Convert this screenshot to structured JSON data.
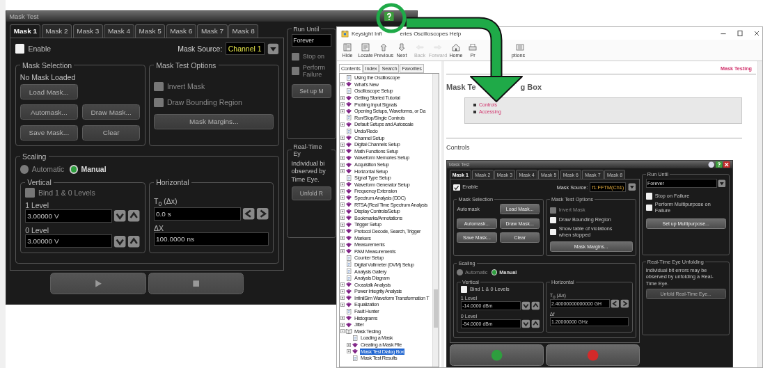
{
  "mask_dialog": {
    "title": "Mask Test",
    "tabs": [
      {
        "label": "Mask 1",
        "selected": true
      },
      {
        "label": "Mask 2",
        "selected": false
      },
      {
        "label": "Mask 3",
        "selected": false
      },
      {
        "label": "Mask 4",
        "selected": false
      },
      {
        "label": "Mask 5",
        "selected": false
      },
      {
        "label": "Mask 6",
        "selected": false
      },
      {
        "label": "Mask 7",
        "selected": false
      },
      {
        "label": "Mask 8",
        "selected": false
      }
    ],
    "enable": {
      "label": "Enable",
      "checked": false,
      "disabled": false
    },
    "source": {
      "label": "Mask Source:",
      "value": "Channel 1"
    },
    "mask_selection": {
      "title": "Mask Selection",
      "status": "No Mask Loaded",
      "buttons": [
        {
          "label": "Load Mask...",
          "disabled": true
        },
        {
          "label": "Automask...",
          "disabled": true
        },
        {
          "label": "Draw Mask...",
          "disabled": true
        },
        {
          "label": "Save Mask...",
          "disabled": true
        },
        {
          "label": "Clear",
          "disabled": true
        }
      ]
    },
    "options": {
      "title": "Mask Test Options",
      "checkboxes": [
        {
          "lines": [
            "Invert Mask"
          ],
          "checked": false,
          "disabled": true
        },
        {
          "lines": [
            "Draw Bounding Region"
          ],
          "checked": false,
          "disabled": true
        }
      ],
      "button": {
        "label": "Mask Margins...",
        "disabled": true
      }
    },
    "scaling": {
      "title": "Scaling",
      "modes": [
        {
          "label": "Automatic",
          "selected": false,
          "disabled": true
        },
        {
          "label": "Manual",
          "selected": true,
          "disabled": false
        }
      ],
      "vertical": {
        "title": "Vertical",
        "bind": {
          "lines": [
            "Bind 1 & 0 Levels"
          ],
          "checked": false,
          "disabled": true
        },
        "levels": [
          {
            "label": "1 Level",
            "value": "3.00000 V"
          },
          {
            "label": "0 Level",
            "value": "3.00000 V"
          }
        ]
      },
      "horizontal": {
        "title": "Horizontal",
        "offset_label": "T$_{0}$ (Δx)",
        "offset_value": "0.0 s",
        "span_label": "ΔX",
        "span_value": "100.0000 ns"
      }
    },
    "run_until": {
      "title": "Run Until",
      "value": "Forever",
      "checkboxes": [
        {
          "lines": [
            "Stop on"
          ],
          "checked": false,
          "disabled": true
        },
        {
          "lines": [
            "Perform",
            "Failure"
          ],
          "checked": false,
          "disabled": true
        }
      ],
      "button": {
        "label": "Set up M",
        "disabled": true
      }
    },
    "eye": {
      "title": "Real-Time Ey",
      "lines": [
        "Individual bi",
        "observed by",
        "Time Eye."
      ],
      "button": {
        "label": "Unfold R",
        "disabled": true
      }
    },
    "footer": [
      {
        "kind": "run",
        "disabled": true
      },
      {
        "kind": "stop",
        "disabled": true
      }
    ]
  },
  "help_window": {
    "title_parts": [
      "Keysight Infi",
      "eries Oscilloscopes Help"
    ],
    "toolbar": [
      {
        "label": "Hide",
        "kind": "hide",
        "disabled": false
      },
      {
        "label": "Locate",
        "kind": "locate",
        "disabled": false
      },
      {
        "label": "Previous",
        "kind": "previous",
        "disabled": false
      },
      {
        "label": "Next",
        "kind": "next",
        "disabled": false
      },
      {
        "label": "Back",
        "kind": "back",
        "disabled": true
      },
      {
        "label": "Forward",
        "kind": "forward",
        "disabled": true
      },
      {
        "label": "Home",
        "kind": "home",
        "disabled": false
      },
      {
        "label": "Pr",
        "kind": "print",
        "disabled": false
      },
      {
        "label": "ptions",
        "kind": "options",
        "disabled": false
      }
    ],
    "nav_tabs": [
      {
        "label": "Contents",
        "selected": true
      },
      {
        "label": "Index",
        "selected": false
      },
      {
        "label": "Search",
        "selected": false
      },
      {
        "label": "Favorites",
        "selected": false
      }
    ],
    "tree": [
      {
        "label": "Using the Oscilloscope",
        "kind": "page",
        "selected": false
      },
      {
        "label": "What's New",
        "kind": "book",
        "expanded": false,
        "selected": false
      },
      {
        "label": "Oscilloscope Setup",
        "kind": "page",
        "selected": false
      },
      {
        "label": "Getting Started Tutorial",
        "kind": "book",
        "expanded": false,
        "selected": false
      },
      {
        "label": "Probing Input Signals",
        "kind": "book",
        "expanded": false,
        "selected": false
      },
      {
        "label": "Opening Setups, Waveforms, or Da",
        "kind": "book",
        "expanded": false,
        "selected": false
      },
      {
        "label": "Run/Stop/Single Controls",
        "kind": "page",
        "selected": false
      },
      {
        "label": "Default Setups and Autoscale",
        "kind": "book",
        "expanded": false,
        "selected": false
      },
      {
        "label": "Undo/Redo",
        "kind": "page",
        "selected": false
      },
      {
        "label": "Channel Setup",
        "kind": "book",
        "expanded": false,
        "selected": false
      },
      {
        "label": "Digital Channels Setup",
        "kind": "book",
        "expanded": false,
        "selected": false
      },
      {
        "label": "Math Functions Setup",
        "kind": "book",
        "expanded": false,
        "selected": false
      },
      {
        "label": "Waveform Memories Setup",
        "kind": "book",
        "expanded": false,
        "selected": false
      },
      {
        "label": "Acquisition Setup",
        "kind": "book",
        "expanded": false,
        "selected": false
      },
      {
        "label": "Horizontal Setup",
        "kind": "book",
        "expanded": false,
        "selected": false
      },
      {
        "label": "Signal Type Setup",
        "kind": "page",
        "selected": false
      },
      {
        "label": "Waveform Generator Setup",
        "kind": "book",
        "expanded": false,
        "selected": false
      },
      {
        "label": "Frequency Extension",
        "kind": "book",
        "expanded": false,
        "selected": false
      },
      {
        "label": "Spectrum Analysis (DDC)",
        "kind": "book",
        "expanded": false,
        "selected": false
      },
      {
        "label": "RTSA (Real Time Spectrum Analysis",
        "kind": "book",
        "expanded": false,
        "selected": false
      },
      {
        "label": "Display Controls/Setup",
        "kind": "book",
        "expanded": false,
        "selected": false
      },
      {
        "label": "Bookmarks/Annotations",
        "kind": "book",
        "expanded": false,
        "selected": false
      },
      {
        "label": "Trigger Setup",
        "kind": "book",
        "expanded": false,
        "selected": false
      },
      {
        "label": "Protocol Decode, Search, Trigger",
        "kind": "book",
        "expanded": false,
        "selected": false
      },
      {
        "label": "Markers",
        "kind": "book",
        "expanded": false,
        "selected": false
      },
      {
        "label": "Measurements",
        "kind": "book",
        "expanded": false,
        "selected": false
      },
      {
        "label": "PAM Measurements",
        "kind": "book",
        "expanded": false,
        "selected": false
      },
      {
        "label": "Counter Setup",
        "kind": "page",
        "selected": false
      },
      {
        "label": "Digital Voltmeter (DVM) Setup",
        "kind": "page",
        "selected": false
      },
      {
        "label": "Analysis Gallery",
        "kind": "page",
        "selected": false
      },
      {
        "label": "Analysis Diagram",
        "kind": "page",
        "selected": false
      },
      {
        "label": "Crosstalk Analysis",
        "kind": "book",
        "expanded": false,
        "selected": false
      },
      {
        "label": "Power Integrity Analysis",
        "kind": "book",
        "expanded": false,
        "selected": false
      },
      {
        "label": "InfiniiSim Waveform Transformation T",
        "kind": "book",
        "expanded": false,
        "selected": false
      },
      {
        "label": "Equalization",
        "kind": "book",
        "expanded": false,
        "selected": false
      },
      {
        "label": "Fault Hunter",
        "kind": "page",
        "selected": false
      },
      {
        "label": "Histograms",
        "kind": "book",
        "expanded": false,
        "selected": false
      },
      {
        "label": "Jitter",
        "kind": "book",
        "expanded": false,
        "selected": false
      },
      {
        "label": "Mask Testing",
        "kind": "book",
        "expanded": true,
        "selected": false,
        "children": [
          {
            "label": "Loading a Mask",
            "kind": "page",
            "selected": false
          },
          {
            "label": "Creating a Mask File",
            "kind": "book",
            "expanded": false,
            "selected": false
          },
          {
            "label": "Mask Test Dialog Box",
            "kind": "book",
            "expanded": false,
            "selected": true
          },
          {
            "label": "Mask Test Results",
            "kind": "page",
            "selected": false
          }
        ]
      }
    ],
    "breadcrumb": "Mask Testing",
    "heading_parts": [
      "Mask Te",
      "g Box"
    ],
    "links": [
      "Controls",
      "Accessing"
    ],
    "section": "Controls",
    "screenshot": {
      "title": "Mask Test",
      "tabs": [
        {
          "label": "Mask 1",
          "selected": true
        },
        {
          "label": "Mask 2",
          "selected": false
        },
        {
          "label": "Mask 3",
          "selected": false
        },
        {
          "label": "Mask 4",
          "selected": false
        },
        {
          "label": "Mask 5",
          "selected": false
        },
        {
          "label": "Mask 6",
          "selected": false
        },
        {
          "label": "Mask 7",
          "selected": false
        },
        {
          "label": "Mask 8",
          "selected": false
        }
      ],
      "enable": {
        "label": "Enable",
        "checked": true,
        "disabled": false
      },
      "source": {
        "label": "Mask Source:",
        "value": "f1:FFTM(Ch1)"
      },
      "mask_selection": {
        "title": "Mask Selection",
        "status": "Automask",
        "buttons": [
          {
            "label": "Load Mask...",
            "disabled": false
          },
          {
            "label": "Automask...",
            "disabled": false
          },
          {
            "label": "Draw Mask...",
            "disabled": false
          },
          {
            "label": "Save Mask...",
            "disabled": false
          },
          {
            "label": "Clear",
            "disabled": false
          }
        ]
      },
      "options": {
        "title": "Mask Test Options",
        "checkboxes": [
          {
            "lines": [
              "Invert Mask"
            ],
            "checked": false,
            "disabled": true
          },
          {
            "lines": [
              "Draw Bounding Region"
            ],
            "checked": false,
            "disabled": false
          },
          {
            "lines": [
              "Show table of violations",
              "when stopped"
            ],
            "checked": false,
            "disabled": false
          }
        ],
        "button": {
          "label": "Mask Margins...",
          "disabled": false
        }
      },
      "scaling": {
        "title": "Scaling",
        "modes": [
          {
            "label": "Automatic",
            "selected": false,
            "disabled": true
          },
          {
            "label": "Manual",
            "selected": true,
            "disabled": false
          }
        ],
        "vertical": {
          "title": "Vertical",
          "bind": {
            "lines": [
              "Bind 1 & 0 Levels"
            ],
            "checked": false,
            "disabled": false
          },
          "levels": [
            {
              "label": "1 Level",
              "value": "-14.0000 dBm"
            },
            {
              "label": "0 Level",
              "value": "-54.0000 dBm"
            }
          ]
        },
        "horizontal": {
          "title": "Horizontal",
          "offset_label": "T$_{0}$ (Δx)",
          "offset_value": "2.40000000000000 GH",
          "span_label": "Δf",
          "span_value": "1.20000000 GHz"
        }
      },
      "run_until": {
        "title": "Run Until",
        "value": "Forever",
        "checkboxes": [
          {
            "lines": [
              "Stop on Failure"
            ],
            "checked": false,
            "disabled": false
          },
          {
            "lines": [
              "Perform Multipurpose on",
              "Failure"
            ],
            "checked": false,
            "disabled": false
          }
        ],
        "button": {
          "label": "Set up Multipurpose...",
          "disabled": false
        }
      },
      "eye": {
        "title": "Real-Time Eye Unfolding",
        "lines": [
          "Individual bit errors may be",
          "observed by unfolding a Real-",
          "Time Eye."
        ],
        "button": {
          "label": "Unfold Real-Time Eye...",
          "disabled": true
        }
      },
      "footer": [
        {
          "kind": "ok",
          "disabled": false
        },
        {
          "kind": "cancel",
          "disabled": false
        }
      ]
    }
  }
}
